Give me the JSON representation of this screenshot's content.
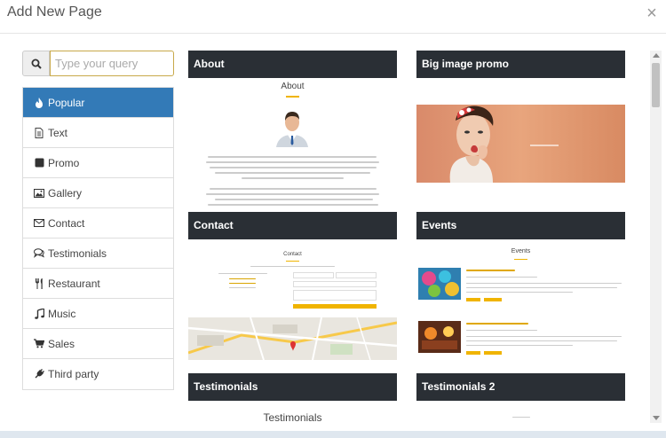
{
  "modal": {
    "title": "Add New Page",
    "close_symbol": "×"
  },
  "search": {
    "placeholder": "Type your query",
    "value": ""
  },
  "categories": [
    {
      "label": "Popular",
      "icon": "fire-icon",
      "active": true
    },
    {
      "label": "Text",
      "icon": "file-text-icon",
      "active": false
    },
    {
      "label": "Promo",
      "icon": "square-icon",
      "active": false
    },
    {
      "label": "Gallery",
      "icon": "image-icon",
      "active": false
    },
    {
      "label": "Contact",
      "icon": "envelope-icon",
      "active": false
    },
    {
      "label": "Testimonials",
      "icon": "comments-icon",
      "active": false
    },
    {
      "label": "Restaurant",
      "icon": "cutlery-icon",
      "active": false
    },
    {
      "label": "Music",
      "icon": "music-icon",
      "active": false
    },
    {
      "label": "Sales",
      "icon": "cart-icon",
      "active": false
    },
    {
      "label": "Third party",
      "icon": "plug-icon",
      "active": false
    }
  ],
  "templates": [
    {
      "title": "About",
      "preview_heading": "About"
    },
    {
      "title": "Big image promo"
    },
    {
      "title": "Contact",
      "preview_heading": "Contact"
    },
    {
      "title": "Events",
      "preview_heading": "Events"
    },
    {
      "title": "Testimonials",
      "preview_heading": "Testimonials"
    },
    {
      "title": "Testimonials 2"
    }
  ],
  "colors": {
    "accent": "#337ab7",
    "card_header": "#2a2f35",
    "gold": "#f0b400"
  }
}
